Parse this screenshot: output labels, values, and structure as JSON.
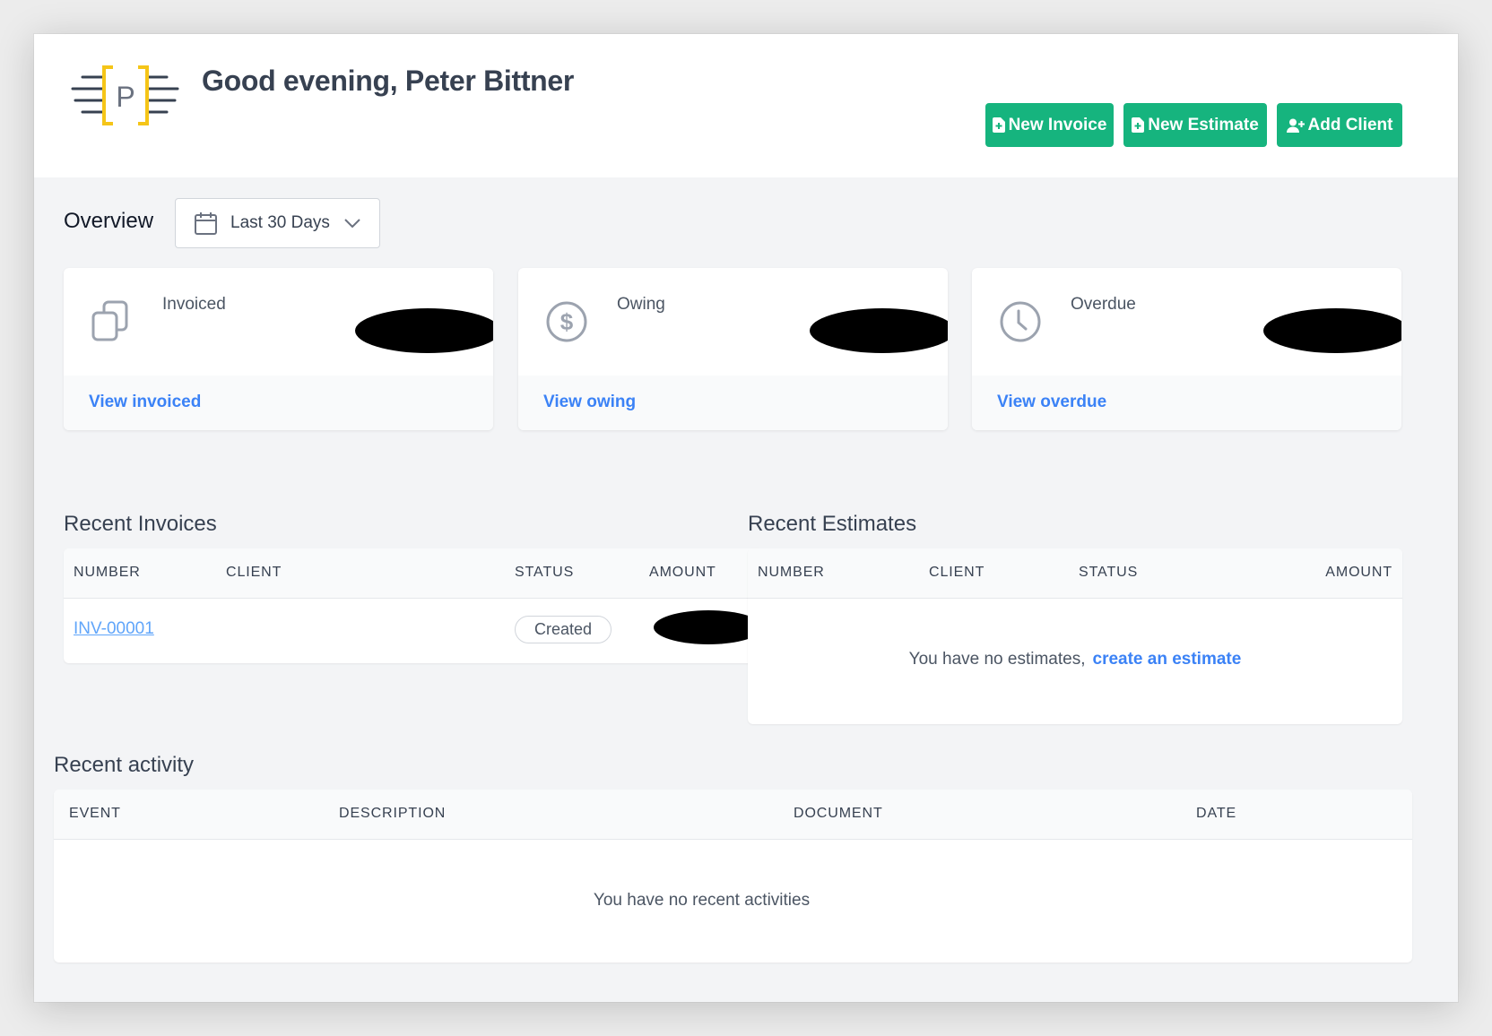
{
  "header": {
    "logo_letter": "P",
    "greeting": "Good evening, Peter Bittner",
    "buttons": {
      "new_invoice": "New Invoice",
      "new_estimate": "New Estimate",
      "add_client": "Add Client"
    }
  },
  "overview": {
    "label": "Overview",
    "range": "Last 30 Days",
    "cards": [
      {
        "title": "Invoiced",
        "link": "View invoiced",
        "icon": "copy-icon"
      },
      {
        "title": "Owing",
        "link": "View owing",
        "icon": "dollar-icon"
      },
      {
        "title": "Overdue",
        "link": "View overdue",
        "icon": "clock-icon"
      }
    ]
  },
  "recent_invoices": {
    "title": "Recent Invoices",
    "columns": [
      "NUMBER",
      "CLIENT",
      "STATUS",
      "AMOUNT"
    ],
    "rows": [
      {
        "number": "INV-00001",
        "client": "",
        "status": "Created"
      }
    ]
  },
  "recent_estimates": {
    "title": "Recent Estimates",
    "columns": [
      "NUMBER",
      "CLIENT",
      "STATUS",
      "AMOUNT"
    ],
    "empty_text": "You have no estimates,",
    "empty_link": "create an estimate"
  },
  "recent_activity": {
    "title": "Recent activity",
    "columns": [
      "EVENT",
      "DESCRIPTION",
      "DOCUMENT",
      "DATE"
    ],
    "empty_text": "You have no recent activities"
  },
  "colors": {
    "accent_green": "#16b47e",
    "link_blue": "#3b82f6",
    "logo_yellow": "#f5c518"
  }
}
